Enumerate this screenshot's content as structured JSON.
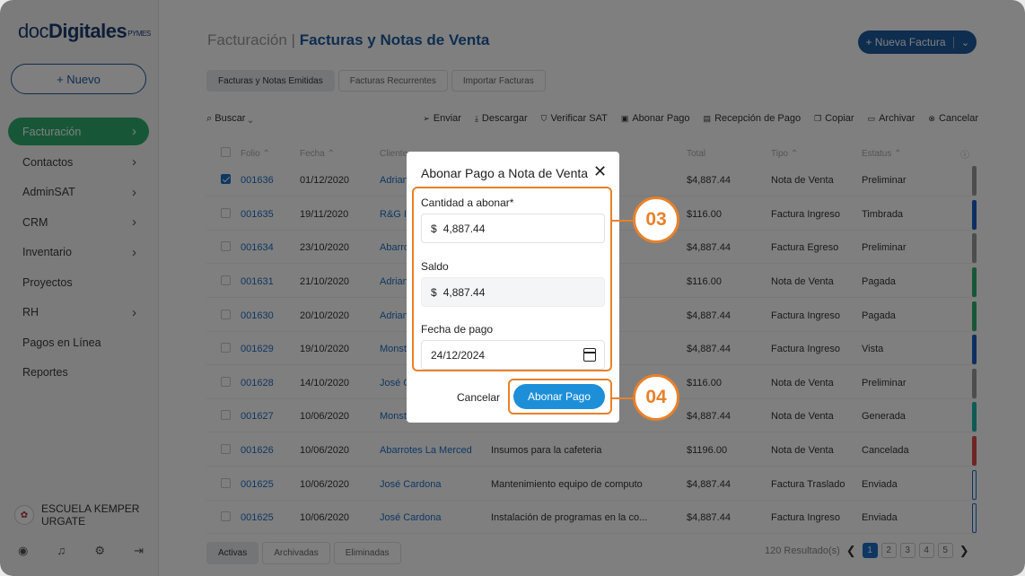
{
  "logo": {
    "part1": "doc",
    "part2": "Digitales",
    "part3": "PYMES"
  },
  "sidebar": {
    "new_button": "+ Nuevo",
    "items": [
      {
        "label": "Facturación",
        "chevron": true,
        "active": true
      },
      {
        "label": "Contactos",
        "chevron": true
      },
      {
        "label": "AdminSAT",
        "chevron": true
      },
      {
        "label": "CRM",
        "chevron": true
      },
      {
        "label": "Inventario",
        "chevron": true
      },
      {
        "label": "Proyectos",
        "chevron": false
      },
      {
        "label": "RH",
        "chevron": true
      },
      {
        "label": "Pagos en Línea",
        "chevron": false
      },
      {
        "label": "Reportes",
        "chevron": false
      }
    ],
    "user_name_line1": "ESCUELA KEMPER",
    "user_name_line2": "URGATE",
    "bottom_icons": [
      "user-circle-icon",
      "bell-icon",
      "gear-icon",
      "logout-icon"
    ]
  },
  "header": {
    "crumb_section": "Facturación |",
    "crumb_page": "Facturas y Notas de Venta",
    "new_invoice_button": "+ Nueva Factura",
    "new_invoice_dropdown": "⌄"
  },
  "tabs": [
    "Facturas y Notas Emitidas",
    "Facturas Recurrentes",
    "Importar Facturas"
  ],
  "toolbar": {
    "search": "Buscar",
    "actions": [
      {
        "label": "Enviar",
        "icon": "send-icon",
        "glyph": "➢"
      },
      {
        "label": "Descargar",
        "icon": "download-icon",
        "glyph": "⤓"
      },
      {
        "label": "Verificar SAT",
        "icon": "shield-check-icon",
        "glyph": "⛉"
      },
      {
        "label": "Abonar Pago",
        "icon": "money-icon",
        "glyph": "▣"
      },
      {
        "label": "Recepción de Pago",
        "icon": "receipt-icon",
        "glyph": "▤"
      },
      {
        "label": "Copiar",
        "icon": "copy-icon",
        "glyph": "❐"
      },
      {
        "label": "Archivar",
        "icon": "folder-icon",
        "glyph": "▭"
      },
      {
        "label": "Cancelar",
        "icon": "cancel-icon",
        "glyph": "⊗"
      }
    ]
  },
  "table": {
    "headers": [
      "Folio ⌃",
      "Fecha ⌃",
      "Cliente",
      "",
      "Total",
      "Tipo ⌃",
      "Estatus ⌃"
    ],
    "rows": [
      {
        "folio": "001636",
        "fecha": "01/12/2020",
        "cliente": "Adrian",
        "desc": "",
        "total": "$4,887.44",
        "tipo": "Nota de Venta",
        "estatus": "Preliminar",
        "checked": true,
        "bar": "#9a9a9a",
        "outline": false
      },
      {
        "folio": "001635",
        "fecha": "19/11/2020",
        "cliente": "R&G In",
        "desc": "",
        "total": "$116.00",
        "tipo": "Factura Ingreso",
        "estatus": "Timbrada",
        "checked": false,
        "bar": "#1d5fc2",
        "outline": false
      },
      {
        "folio": "001634",
        "fecha": "23/10/2020",
        "cliente": "Abarro",
        "desc": "",
        "total": "$4,887.44",
        "tipo": "Factura Egreso",
        "estatus": "Preliminar",
        "checked": false,
        "bar": "#9a9a9a",
        "outline": false
      },
      {
        "folio": "001631",
        "fecha": "21/10/2020",
        "cliente": "Adrian",
        "desc": "",
        "total": "$116.00",
        "tipo": "Nota de Venta",
        "estatus": "Pagada",
        "checked": false,
        "bar": "#2eaf6e",
        "outline": false
      },
      {
        "folio": "001630",
        "fecha": "20/10/2020",
        "cliente": "Adrian",
        "desc": "",
        "total": "$4,887.44",
        "tipo": "Factura Ingreso",
        "estatus": "Pagada",
        "checked": false,
        "bar": "#2eaf6e",
        "outline": false
      },
      {
        "folio": "001629",
        "fecha": "19/10/2020",
        "cliente": "Monst",
        "desc": "",
        "total": "$4,887.44",
        "tipo": "Factura Ingreso",
        "estatus": "Vista",
        "checked": false,
        "bar": "#1d5fc2",
        "outline": false
      },
      {
        "folio": "001628",
        "fecha": "14/10/2020",
        "cliente": "José C",
        "desc": "",
        "total": "$116.00",
        "tipo": "Nota de Venta",
        "estatus": "Preliminar",
        "checked": false,
        "bar": "#9a9a9a",
        "outline": false
      },
      {
        "folio": "001627",
        "fecha": "10/06/2020",
        "cliente": "Monst",
        "desc": "",
        "total": "$4,887.44",
        "tipo": "Nota de Venta",
        "estatus": "Generada",
        "checked": false,
        "bar": "#1fb5a8",
        "outline": false
      },
      {
        "folio": "001626",
        "fecha": "10/06/2020",
        "cliente": "Abarrotes La Merced",
        "desc": "Insumos para la cafeteria",
        "total": "$1196.00",
        "tipo": "Nota de Venta",
        "estatus": "Cancelada",
        "checked": false,
        "bar": "#e04a4a",
        "outline": false
      },
      {
        "folio": "001625",
        "fecha": "10/06/2020",
        "cliente": "José Cardona",
        "desc": "Mantenimiento equipo de computo",
        "total": "$4,887.44",
        "tipo": "Factura Traslado",
        "estatus": "Enviada",
        "checked": false,
        "bar": "#1d6fc4",
        "outline": true
      },
      {
        "folio": "001625",
        "fecha": "10/06/2020",
        "cliente": "José Cardona",
        "desc": "Instalación de programas en la co...",
        "total": "$4,887.44",
        "tipo": "Factura Ingreso",
        "estatus": "Enviada",
        "checked": false,
        "bar": "#1d6fc4",
        "outline": true
      }
    ]
  },
  "bottom_tabs": [
    "Activas",
    "Archivadas",
    "Eliminadas"
  ],
  "pager": {
    "results": "120 Resultado(s)",
    "pages": [
      "1",
      "2",
      "3",
      "4",
      "5"
    ],
    "current": "1",
    "prev": "❮",
    "next": "❯"
  },
  "modal": {
    "title": "Abonar Pago a Nota de Venta",
    "close": "✕",
    "amount_label": "Cantidad a abonar*",
    "currency": "$",
    "amount_value": "4,887.44",
    "balance_label": "Saldo",
    "balance_value": "4,887.44",
    "date_label": "Fecha de pago",
    "date_value": "24/12/2024",
    "cancel": "Cancelar",
    "submit": "Abonar Pago"
  },
  "callouts": {
    "fields_step": "03",
    "submit_step": "04",
    "color": "#e8812a"
  }
}
